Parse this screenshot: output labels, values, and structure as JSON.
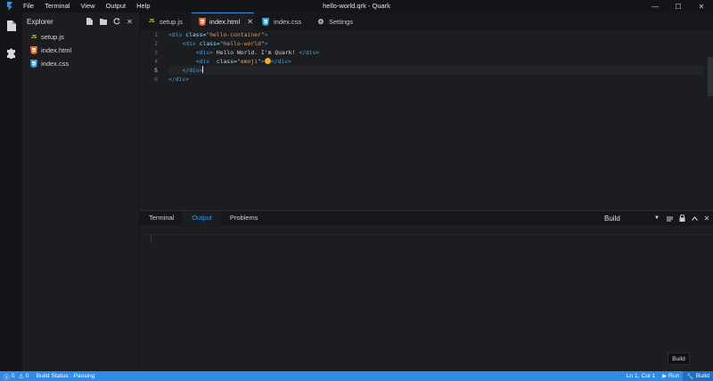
{
  "window": {
    "title": "hello-world.qrk - Quark",
    "controls": {
      "minimize": "—",
      "maximize": "☐",
      "close": "✕"
    }
  },
  "menu": [
    "File",
    "Terminal",
    "View",
    "Output",
    "Help"
  ],
  "activity_bar": {
    "icons": [
      "files-icon",
      "extensions-icon"
    ]
  },
  "explorer": {
    "title": "Explorer",
    "actions": [
      "new-file-icon",
      "new-folder-icon",
      "refresh-icon",
      "close-icon"
    ],
    "files": [
      {
        "name": "setup.js",
        "type": "js",
        "badge": "JS",
        "color": "#e8d44d"
      },
      {
        "name": "index.html",
        "type": "html",
        "badge": "5",
        "color": "#e96a2d"
      },
      {
        "name": "index.css",
        "type": "css",
        "badge": "3",
        "color": "#2f9fe0"
      }
    ]
  },
  "tabs": [
    {
      "label": "setup.js",
      "badge": "JS",
      "color": "#e8d44d",
      "active": false
    },
    {
      "label": "index.html",
      "badge": "5",
      "color": "#e96a2d",
      "active": true,
      "close": "✕"
    },
    {
      "label": "index.css",
      "badge": "3",
      "color": "#2f9fe0",
      "active": false
    },
    {
      "label": "Settings",
      "badge": "⚙",
      "color": "#d0d0d0",
      "active": false
    }
  ],
  "editor": {
    "current_line": 5,
    "lines": [
      {
        "no": "1",
        "indent": "",
        "tokens": [
          [
            "tag",
            "<div "
          ],
          [
            "attr",
            "class="
          ],
          [
            "str",
            "\"hello-container\""
          ],
          [
            "tag",
            ">"
          ]
        ]
      },
      {
        "no": "2",
        "indent": "    ",
        "tokens": [
          [
            "tag",
            "<div "
          ],
          [
            "attr",
            "class="
          ],
          [
            "str",
            "\"hello-world\""
          ],
          [
            "tag",
            ">"
          ]
        ]
      },
      {
        "no": "3",
        "indent": "        ",
        "tokens": [
          [
            "tag",
            "<div>"
          ],
          [
            "text",
            " Hello World. I'm Quark! "
          ],
          [
            "tag",
            "</div>"
          ]
        ]
      },
      {
        "no": "4",
        "indent": "        ",
        "tokens": [
          [
            "tag",
            "<div "
          ],
          [
            "attr",
            " class="
          ],
          [
            "str",
            "\"emoji\""
          ],
          [
            "tag",
            ">"
          ],
          [
            "emoji",
            ""
          ],
          [
            "tag",
            "</div>"
          ]
        ]
      },
      {
        "no": "5",
        "indent": "    ",
        "tokens": [
          [
            "tag",
            "</div>"
          ],
          [
            "cursor",
            ""
          ]
        ]
      },
      {
        "no": "6",
        "indent": "",
        "tokens": [
          [
            "tag",
            "</div>"
          ]
        ]
      }
    ]
  },
  "panel": {
    "tabs": [
      {
        "label": "Terminal",
        "active": false
      },
      {
        "label": "Output",
        "active": true
      },
      {
        "label": "Problems",
        "active": false
      }
    ],
    "select_value": "Build",
    "actions": [
      "clear-output-icon",
      "lock-icon",
      "maximize-panel-icon",
      "close-panel-icon"
    ]
  },
  "tooltip": "Build",
  "status": {
    "errors": "0",
    "warnings": "0",
    "build_label": "Build Status : ",
    "build_state": "Passing",
    "position": "Ln 1, Col 1",
    "run": "Run",
    "build": "Build"
  },
  "colors": {
    "accent": "#2f8ae8",
    "status_bar": "#2f8ae8",
    "editor_bg": "#1b1d20"
  }
}
